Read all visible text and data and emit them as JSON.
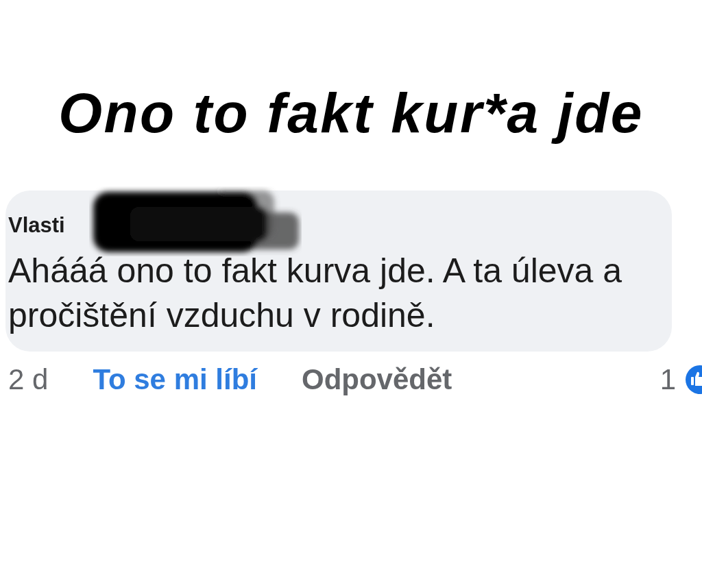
{
  "headline": "Ono to fakt kur*a jde",
  "comment": {
    "author": "Vlasti",
    "author_redacted": true,
    "text": "Ahááá ono to fakt kurva jde. A ta úleva a pročištění vzduchu v rodině."
  },
  "actions": {
    "time": "2 d",
    "like": {
      "label": "To se mi líbí",
      "active": true
    },
    "reply": {
      "label": "Odpovědět"
    },
    "reactions": {
      "count": "1"
    }
  }
}
